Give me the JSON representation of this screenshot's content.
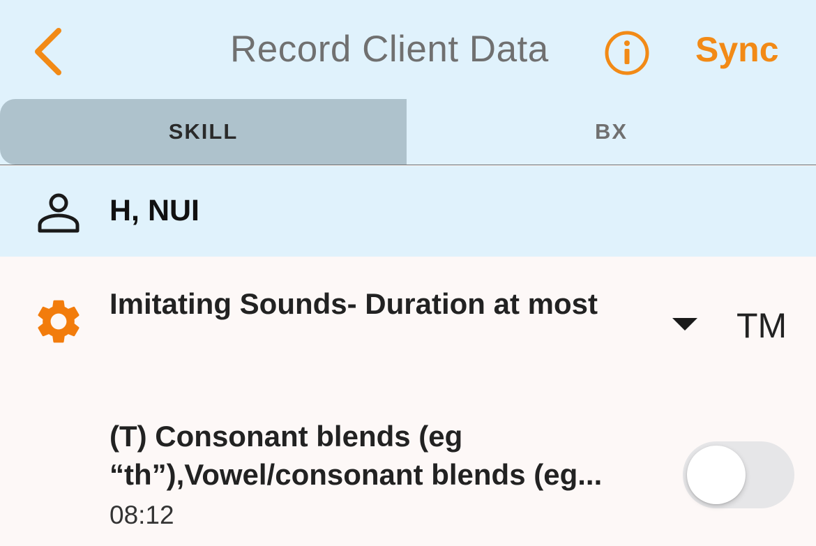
{
  "header": {
    "title": "Record Client Data",
    "sync_label": "Sync",
    "back_icon": "chevron-left-icon",
    "info_icon": "info-icon",
    "accent_color": "#f28a16"
  },
  "tabs": [
    {
      "label": "SKILL",
      "selected": true
    },
    {
      "label": "BX",
      "selected": false
    }
  ],
  "client": {
    "name": "H, NUI",
    "icon": "person-icon"
  },
  "program": {
    "title": "Imitating Sounds- Duration at most",
    "code": "TM",
    "icon": "gear-icon",
    "dropdown_icon": "caret-down-icon"
  },
  "target": {
    "title": "(T) Consonant blends (eg “th”),Vowel/consonant blends (eg...",
    "time": "08:12",
    "toggle_on": false
  }
}
